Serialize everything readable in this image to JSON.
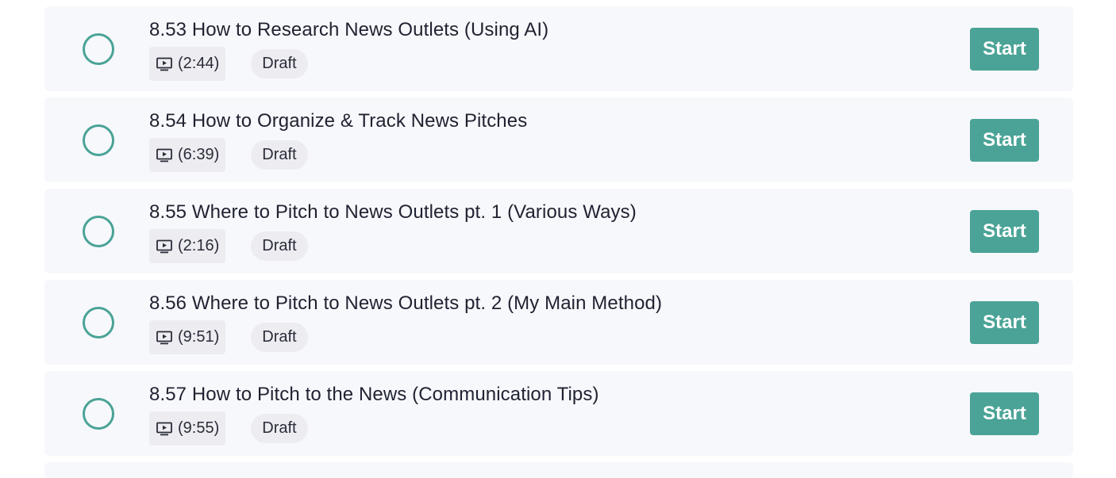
{
  "lessons": [
    {
      "title": "8.53 How to Research News Outlets (Using AI)",
      "duration": "(2:44)",
      "status": "Draft",
      "action": "Start"
    },
    {
      "title": "8.54 How to Organize & Track News Pitches",
      "duration": "(6:39)",
      "status": "Draft",
      "action": "Start"
    },
    {
      "title": "8.55 Where to Pitch to News Outlets pt. 1 (Various Ways)",
      "duration": "(2:16)",
      "status": "Draft",
      "action": "Start"
    },
    {
      "title": "8.56 Where to Pitch to News Outlets pt. 2 (My Main Method)",
      "duration": "(9:51)",
      "status": "Draft",
      "action": "Start"
    },
    {
      "title": "8.57 How to Pitch to the News (Communication Tips)",
      "duration": "(9:55)",
      "status": "Draft",
      "action": "Start"
    }
  ],
  "icons": {
    "status": "circle-outline-icon",
    "duration": "video-play-icon"
  },
  "colors": {
    "accent": "#4aa396",
    "row_background": "#f7f8fc",
    "chip_background": "#ececf1",
    "text": "#1f2230"
  }
}
